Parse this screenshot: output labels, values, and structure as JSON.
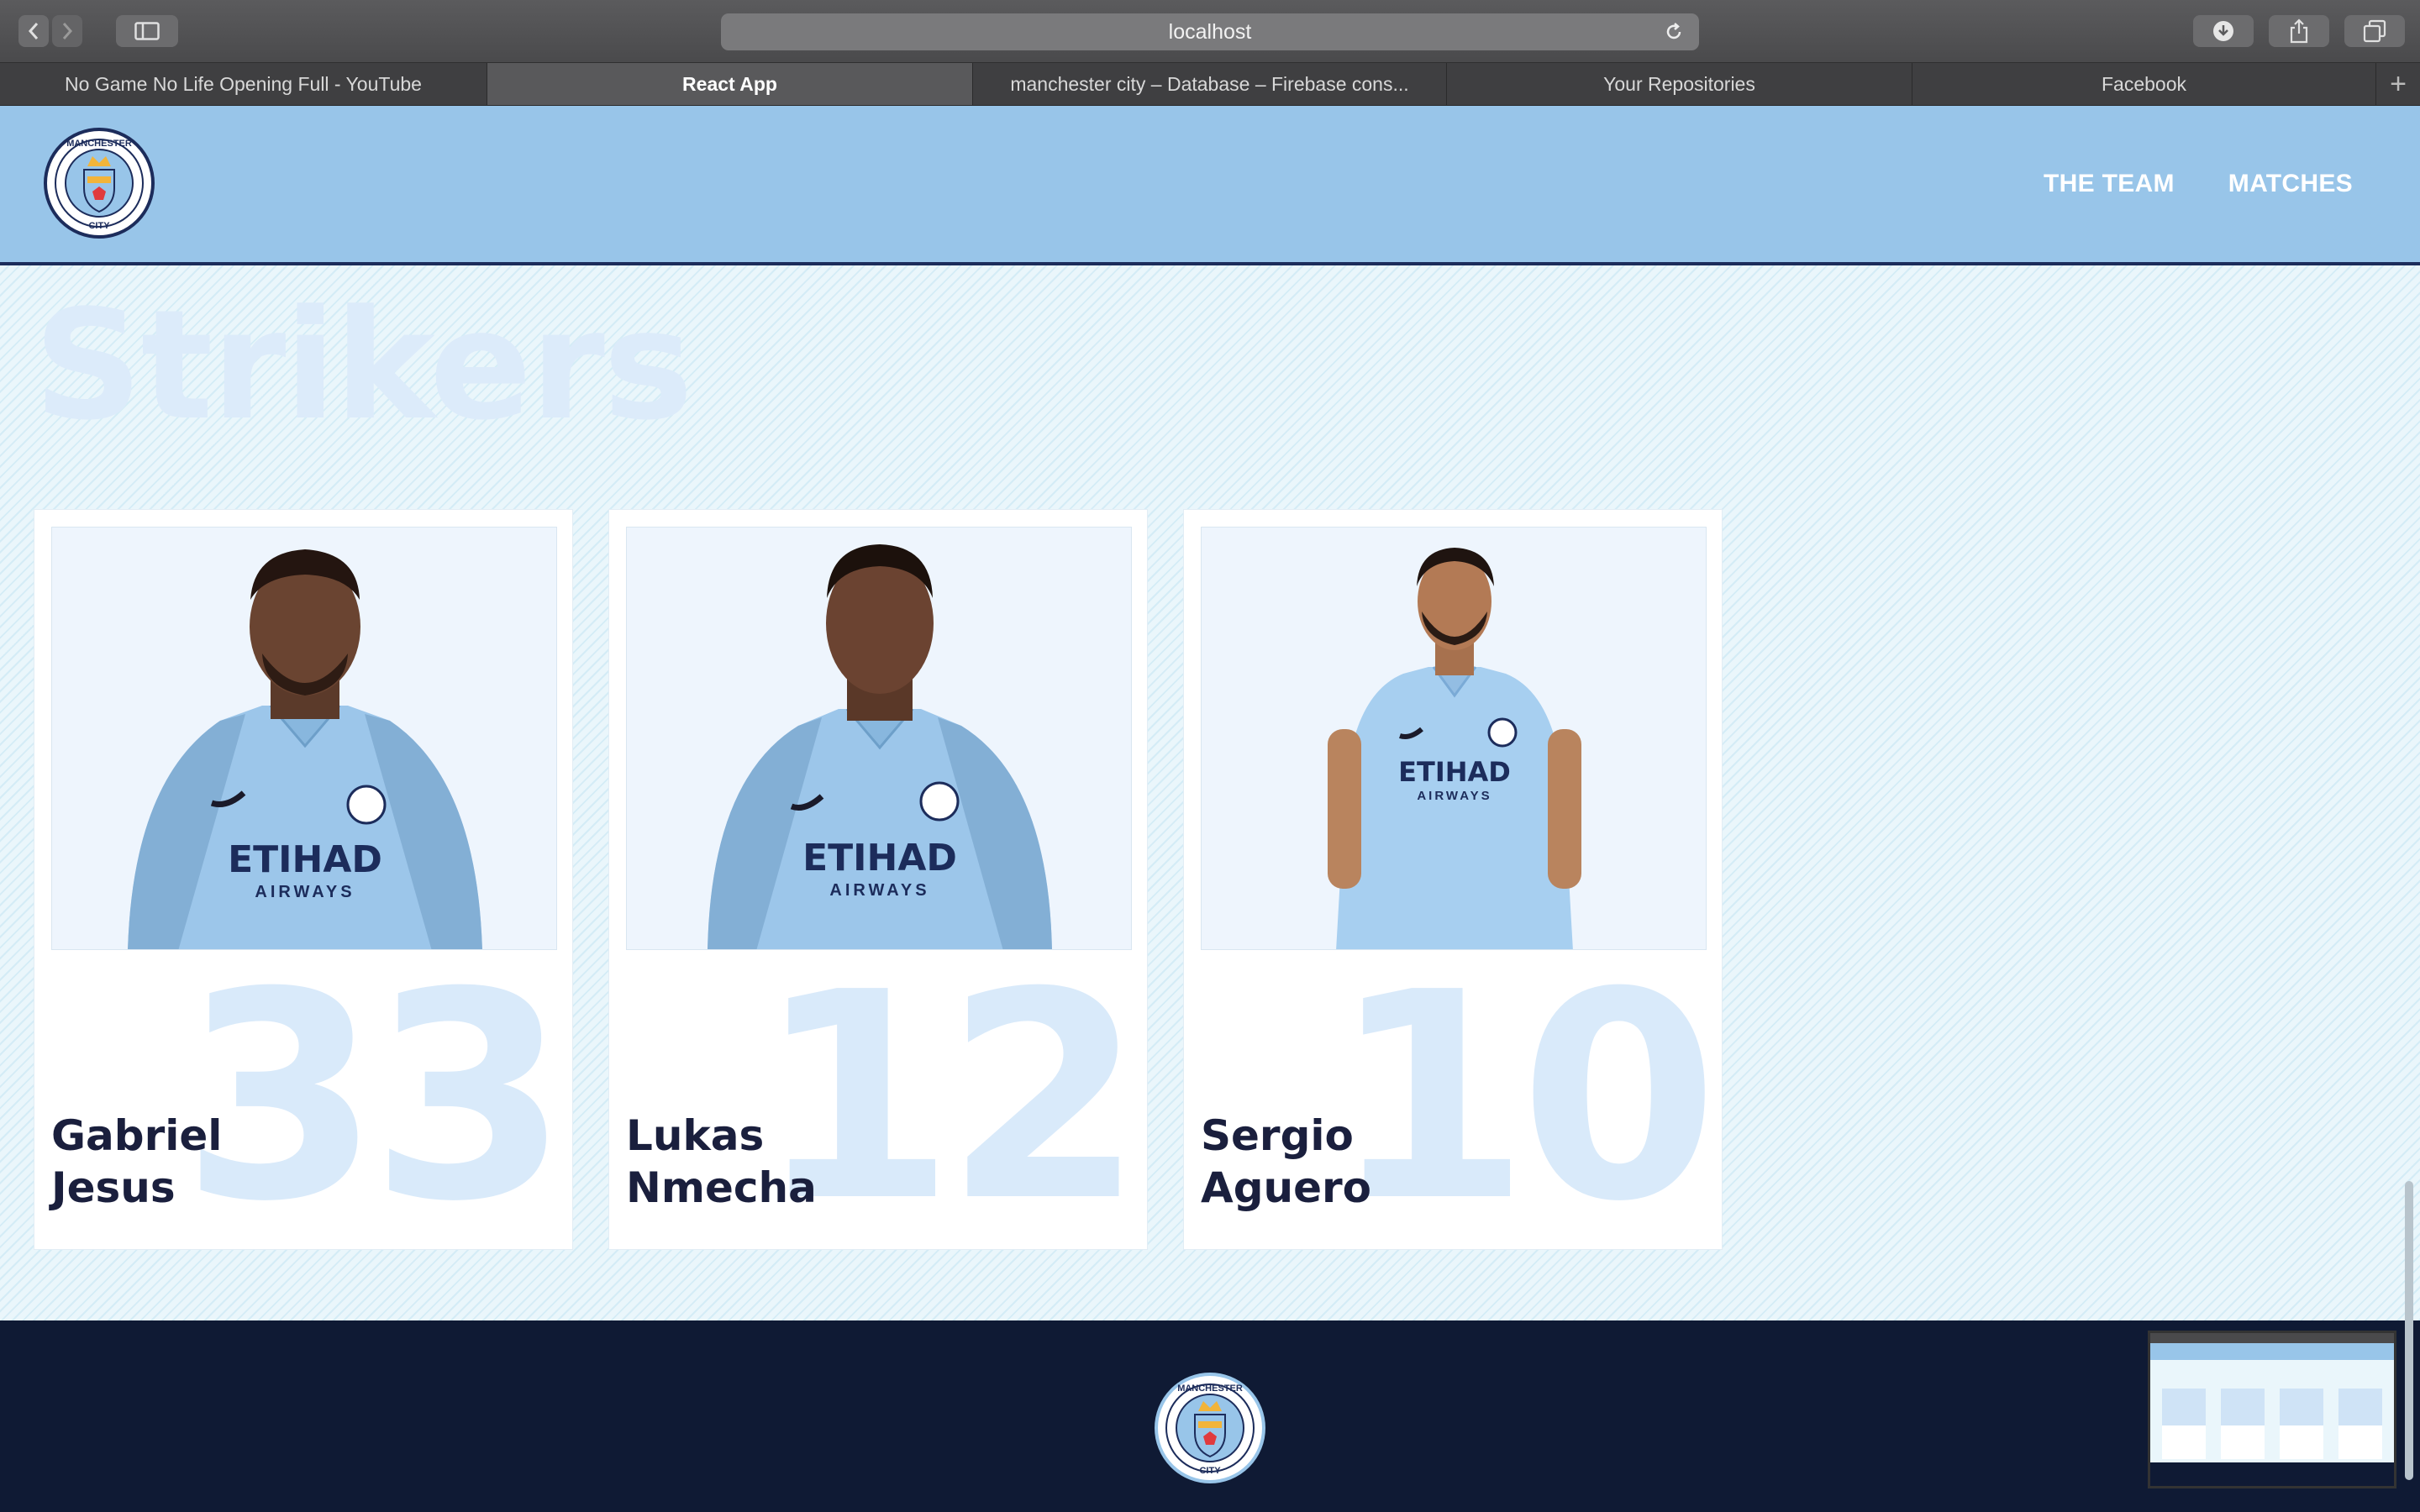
{
  "browser": {
    "url": "localhost",
    "tabs": [
      {
        "label": "No Game No Life Opening Full - YouTube",
        "active": false
      },
      {
        "label": "React App",
        "active": true
      },
      {
        "label": "manchester city – Database – Firebase cons...",
        "active": false
      },
      {
        "label": "Your Repositories",
        "active": false
      },
      {
        "label": "Facebook",
        "active": false
      }
    ],
    "new_tab_label": "+"
  },
  "header": {
    "logo_icon": "manchester-city-crest",
    "logo_text_top": "MANCHESTER",
    "logo_text_bottom": "CITY",
    "nav": [
      {
        "label": "THE TEAM"
      },
      {
        "label": "MATCHES"
      }
    ]
  },
  "section": {
    "title": "Strikers"
  },
  "players": [
    {
      "first_name": "Gabriel",
      "last_name": "Jesus",
      "number": "33"
    },
    {
      "first_name": "Lukas",
      "last_name": "Nmecha",
      "number": "12"
    },
    {
      "first_name": "Sergio",
      "last_name": "Aguero",
      "number": "10"
    }
  ],
  "jersey": {
    "sponsor": "ETIHAD",
    "sponsor_sub": "AIRWAYS"
  },
  "footer": {
    "logo_icon": "manchester-city-crest"
  },
  "colors": {
    "header_bg": "#98c5e9",
    "navy": "#1c2c5b",
    "footer_bg": "#0f1a34",
    "number_color": "#d9eafa",
    "name_color": "#1a1f3d"
  }
}
